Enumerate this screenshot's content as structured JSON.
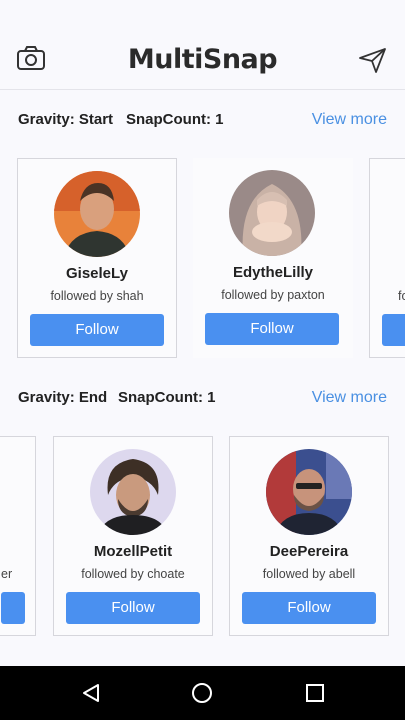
{
  "app": {
    "title": "MultiSnap"
  },
  "sections": [
    {
      "gravity": "Gravity: Start",
      "snap": "SnapCount: 1",
      "more": "View more",
      "cards": [
        {
          "name": "GiseleLy",
          "followed": "followed by shah",
          "button": "Follow"
        },
        {
          "name": "EdytheLilly",
          "followed": "followed by paxton",
          "button": "Follow"
        }
      ],
      "partial_right": "fo"
    },
    {
      "gravity": "Gravity: End",
      "snap": "SnapCount: 1",
      "more": "View more",
      "partial_left": "er",
      "cards": [
        {
          "name": "MozellPetit",
          "followed": "followed by choate",
          "button": "Follow"
        },
        {
          "name": "DeePereira",
          "followed": "followed by abell",
          "button": "Follow"
        }
      ]
    }
  ],
  "colors": {
    "accent": "#4a90f0",
    "link": "#4a90e2"
  },
  "icons": [
    "camera-icon",
    "send-icon",
    "nav-back-icon",
    "nav-home-icon",
    "nav-recents-icon"
  ]
}
